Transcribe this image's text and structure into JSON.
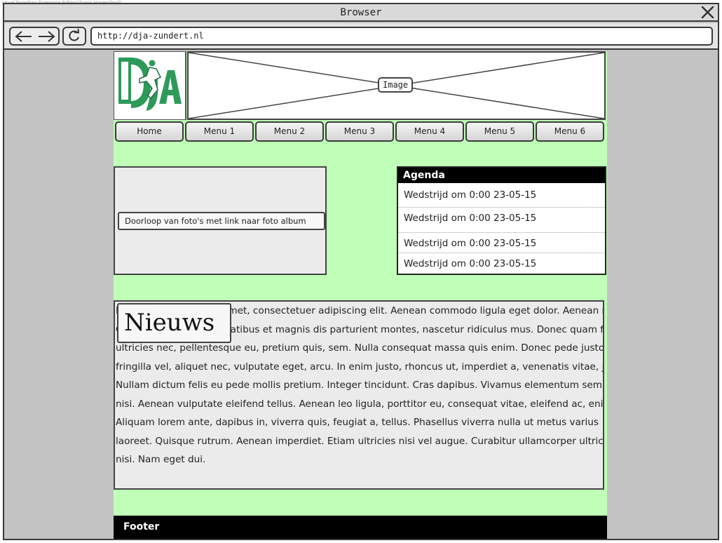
{
  "watermark": "Visual Paradigm Enterprise Edition(Avans Hogeschool)",
  "window": {
    "title": "Browser",
    "url": "http://dja-zundert.nl"
  },
  "header": {
    "banner_label": "Image"
  },
  "menu": [
    "Home",
    "Menu 1",
    "Menu 2",
    "Menu 3",
    "Menu 4",
    "Menu 5",
    "Menu 6"
  ],
  "slideshow": {
    "caption": "Doorloop van foto's met link naar foto album"
  },
  "agenda": {
    "title": "Agenda",
    "items": [
      "Wedstrijd om 0:00 23-05-15",
      "Wedstrijd om 0:00 23-05-15",
      "Wedstrijd om 0:00 23-05-15",
      "Wedstrijd om 0:00 23-05-15"
    ]
  },
  "news": {
    "title": "Nieuws",
    "lines": [
      "Lorem ipsum dolor sit amet, consectetuer adipiscing elit. Aenean commodo ligula eget dolor. Aenean massa.",
      "Cum sociis natoque penatibus et magnis dis parturient montes, nascetur ridiculus mus. Donec quam felis,",
      "ultricies nec, pellentesque eu, pretium quis, sem. Nulla consequat massa quis enim. Donec pede justo,",
      "fringilla vel, aliquet nec, vulputate eget, arcu. In enim justo, rhoncus ut, imperdiet a, venenatis vitae, justo.",
      "Nullam dictum felis eu pede mollis pretium. Integer tincidunt. Cras dapibus. Vivamus elementum semper",
      "nisi. Aenean vulputate eleifend tellus. Aenean leo ligula, porttitor eu, consequat vitae, eleifend ac, enim.",
      "Aliquam lorem ante, dapibus in, viverra quis, feugiat a, tellus. Phasellus viverra nulla ut metus varius",
      "laoreet. Quisque rutrum. Aenean imperdiet. Etiam ultricies nisi vel augue. Curabitur ullamcorper ultricies",
      "nisi. Nam eget dui."
    ]
  },
  "footer": {
    "label": "Footer"
  },
  "colors": {
    "page_background": "#bfffb7",
    "logo_green": "#2e9a5a",
    "footer": "#000000"
  }
}
